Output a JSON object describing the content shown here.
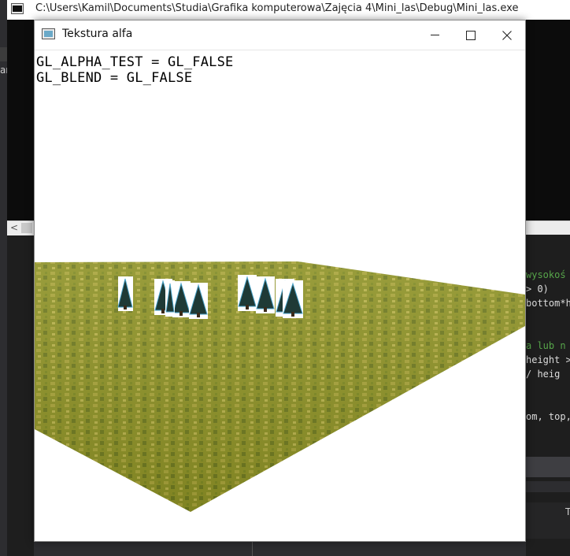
{
  "console_window": {
    "title": "C:\\Users\\Kamil\\Documents\\Studia\\Grafika komputerowa\\Zajęcia 4\\Mini_las\\Debug\\Mini_las.exe",
    "scroll_left_arrow": "<"
  },
  "ide_background": {
    "left_fragment": "an",
    "code_lines": [
      {
        "text": "wysokoś",
        "color": "green"
      },
      {
        "text": "> 0)",
        "color": "white"
      },
      {
        "text": "bottom*h",
        "color": "white"
      },
      {
        "text": "a lub n",
        "color": "green"
      },
      {
        "text": "height >",
        "color": "white"
      },
      {
        "text": "/ heig",
        "color": "white"
      },
      {
        "text": "om, top,",
        "color": "white"
      }
    ],
    "bottom_right_letter": "T"
  },
  "gl_window": {
    "title": "Tekstura alfa",
    "controls": {
      "minimize": "minimize",
      "maximize": "maximize",
      "close": "close"
    },
    "status_lines": [
      "GL_ALPHA_TEST = GL_FALSE",
      "GL_BLEND = GL_FALSE"
    ]
  },
  "scene": {
    "ground_color": "#8e9226",
    "ground_highlight": "#b3ad3c",
    "tree_color": "#1f3a36",
    "billboard_background": "#ffffff",
    "billboard_count": 9
  },
  "colors": {
    "editor_background": "#1e1e1e",
    "console_background": "#0c0c0c",
    "comment_green": "#57a64a"
  }
}
